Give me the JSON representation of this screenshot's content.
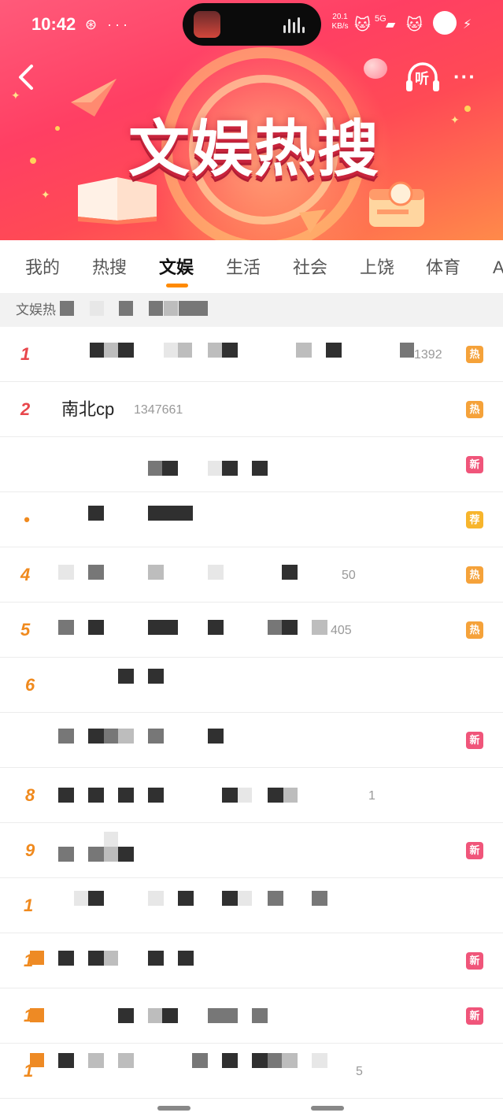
{
  "status_bar": {
    "time": "10:42",
    "left_icons": "⊛ ···",
    "speed_value": "20.1",
    "speed_unit": "KB/s",
    "network": "5G"
  },
  "header": {
    "title": "文娱热搜",
    "listen_label": "听",
    "more_label": "···"
  },
  "tabs": [
    {
      "label": "我的"
    },
    {
      "label": "热搜"
    },
    {
      "label": "文娱"
    },
    {
      "label": "生活"
    },
    {
      "label": "社会"
    },
    {
      "label": "上饶"
    },
    {
      "label": "体育"
    },
    {
      "label": "A"
    }
  ],
  "active_tab": "文娱",
  "subheader": {
    "label": "文娱热"
  },
  "list": [
    {
      "rank": "1",
      "topic": "",
      "count": "1392",
      "badge": "热",
      "badge_type": "hot"
    },
    {
      "rank": "2",
      "topic": "南北cp",
      "count": "1347661",
      "badge": "热",
      "badge_type": "hot"
    },
    {
      "rank": "",
      "topic": "",
      "count": "",
      "badge": "新",
      "badge_type": "new"
    },
    {
      "rank": "•",
      "topic": "",
      "count": "",
      "badge": "荐",
      "badge_type": "rec"
    },
    {
      "rank": "4",
      "topic": "",
      "count": "50",
      "badge": "热",
      "badge_type": "hot"
    },
    {
      "rank": "5",
      "topic": "",
      "count": "405",
      "badge": "热",
      "badge_type": "hot"
    },
    {
      "rank": "6",
      "topic": "",
      "count": "",
      "badge": "",
      "badge_type": ""
    },
    {
      "rank": "",
      "topic": "",
      "count": "",
      "badge": "新",
      "badge_type": "new"
    },
    {
      "rank": "8",
      "topic": "",
      "count": "1",
      "badge": "",
      "badge_type": ""
    },
    {
      "rank": "9",
      "topic": "",
      "count": "",
      "badge": "新",
      "badge_type": "new"
    },
    {
      "rank": "1",
      "topic": "",
      "count": "",
      "badge": "",
      "badge_type": ""
    },
    {
      "rank": "1",
      "topic": "",
      "count": "",
      "badge": "新",
      "badge_type": "new"
    },
    {
      "rank": "1",
      "topic": "",
      "count": "",
      "badge": "新",
      "badge_type": "new"
    },
    {
      "rank": "1",
      "topic": "",
      "count": "5",
      "badge": "",
      "badge_type": ""
    }
  ],
  "colors": {
    "accent": "#ff8a00",
    "rank_top": "#e8474c",
    "rank_other": "#f08a1e",
    "badge_hot": "#f5a23a",
    "badge_new": "#f0557a",
    "badge_rec": "#f7b52c"
  }
}
